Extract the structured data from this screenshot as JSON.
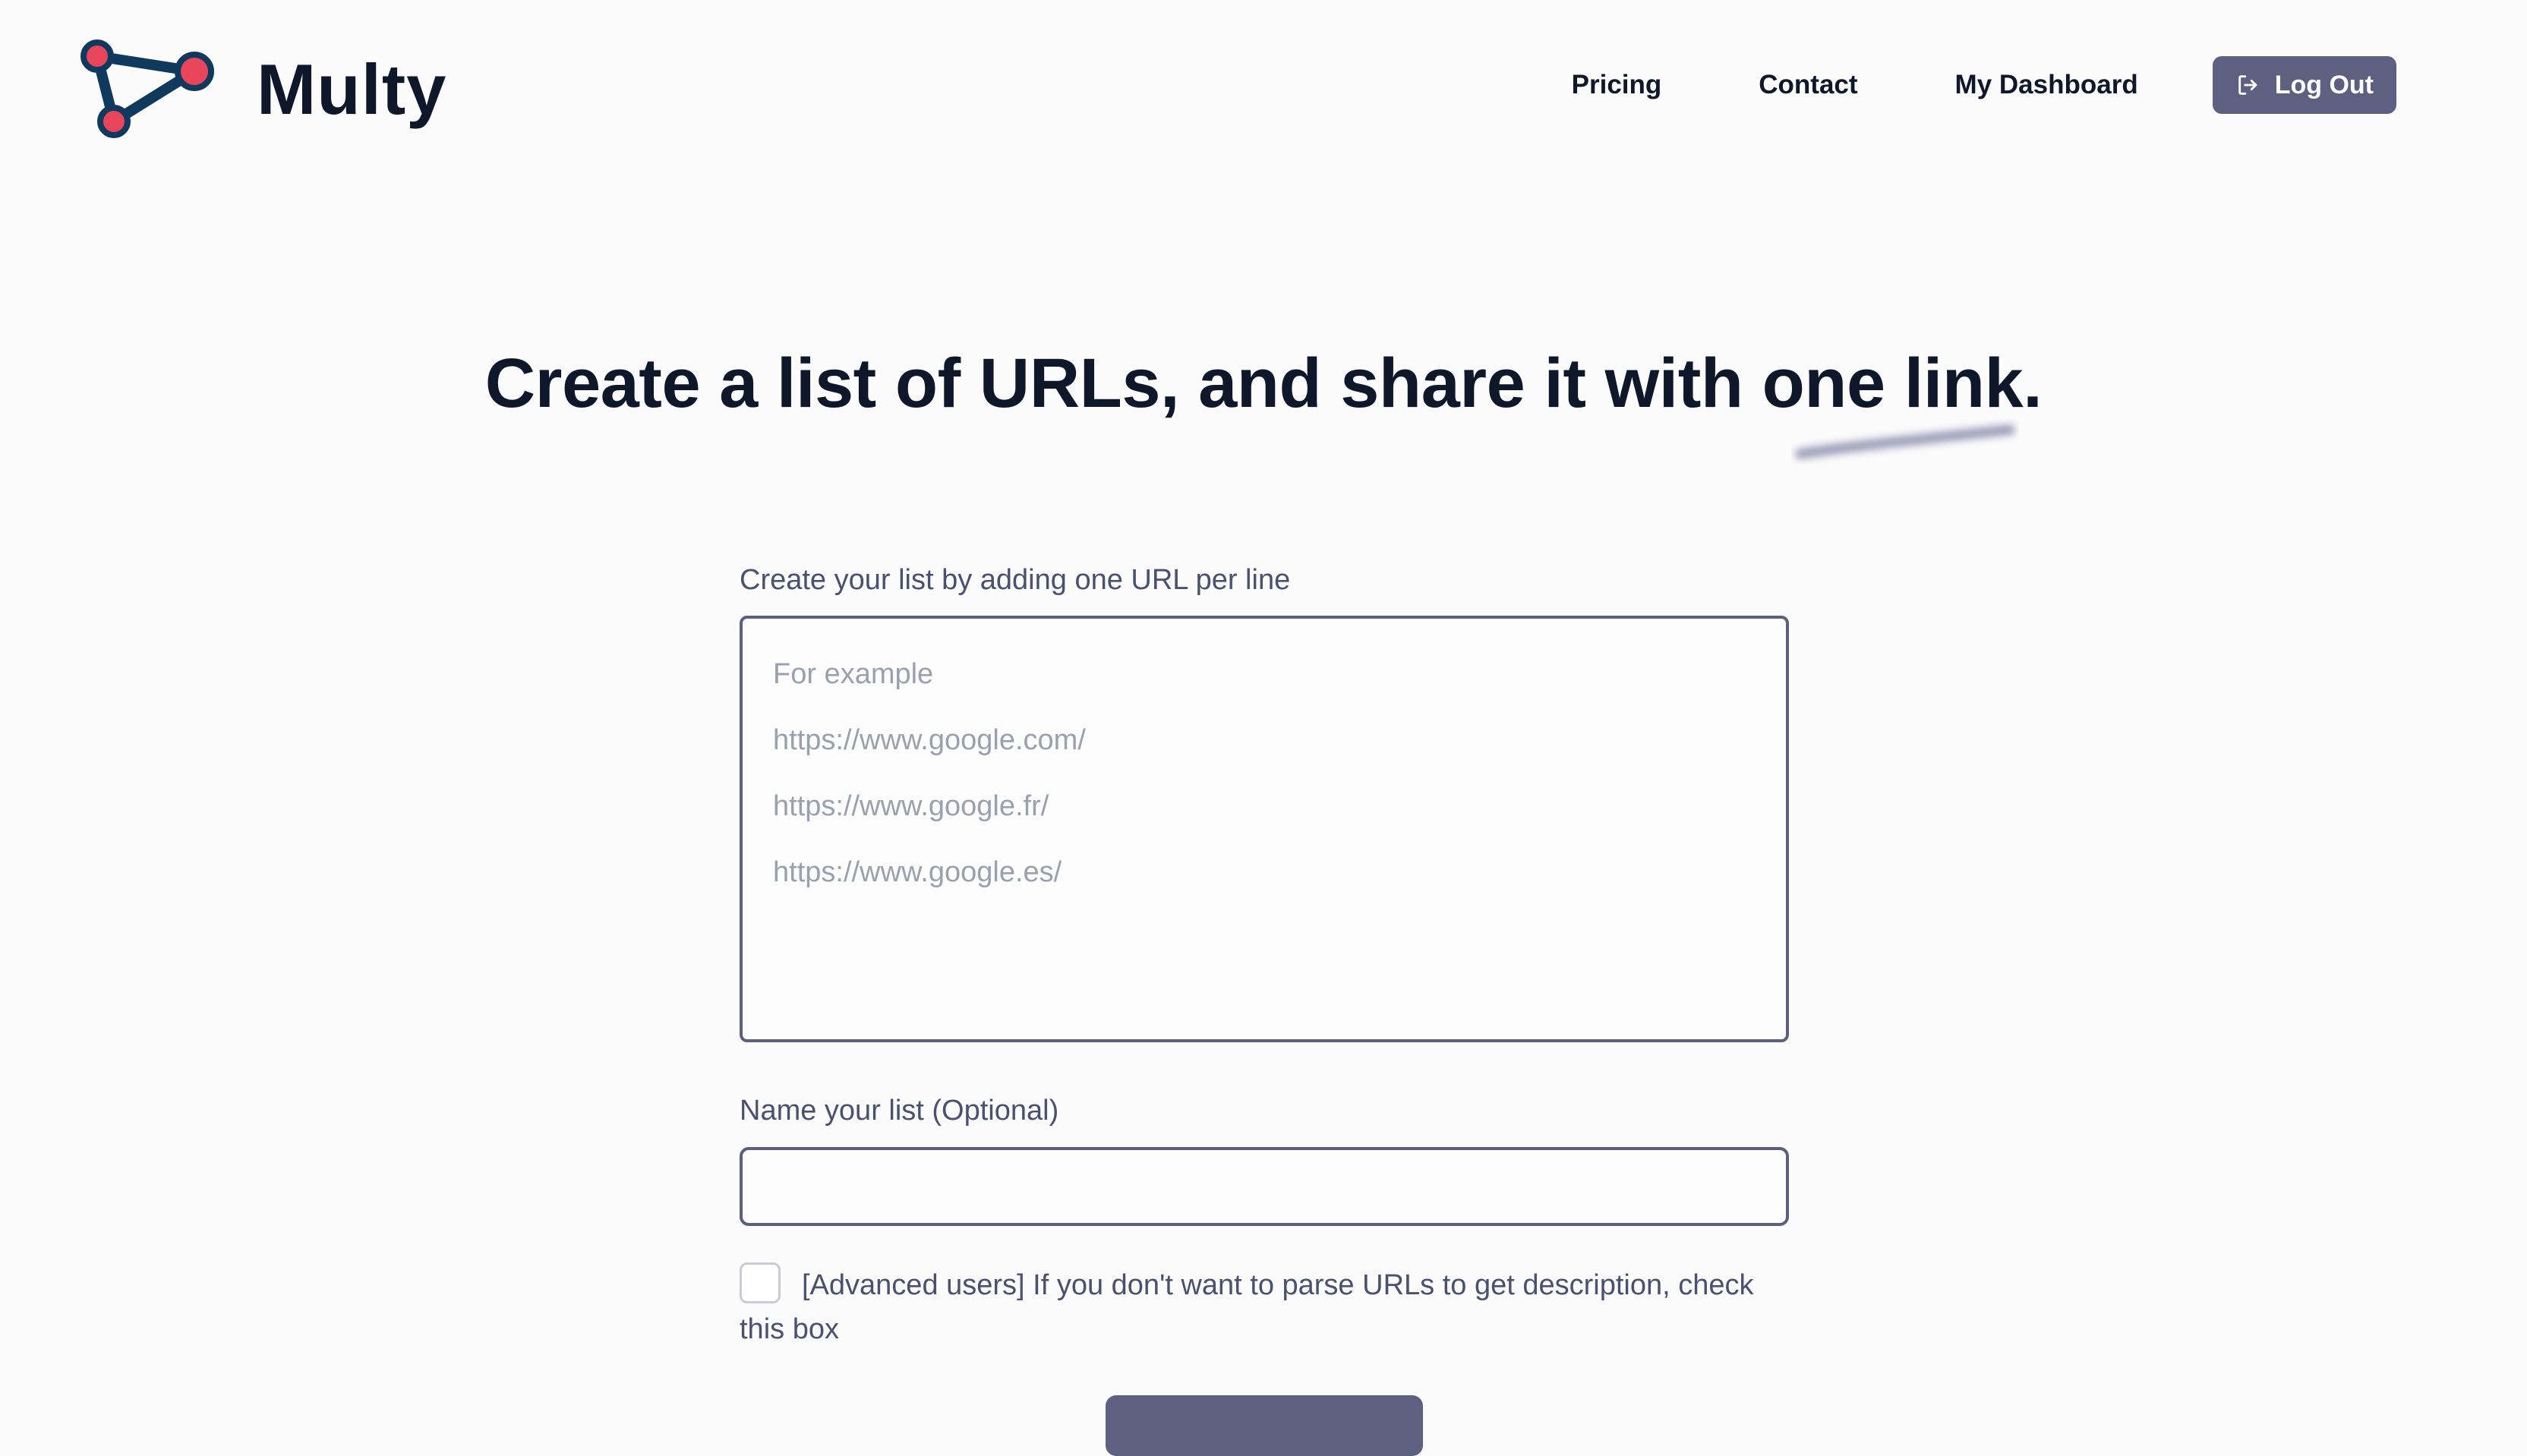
{
  "brand": {
    "name": "Multy",
    "colors": {
      "dark": "#0f3a5e",
      "accent": "#e8445a"
    }
  },
  "nav": {
    "items": [
      {
        "label": "Pricing"
      },
      {
        "label": "Contact"
      },
      {
        "label": "My Dashboard"
      }
    ],
    "logout": {
      "label": "Log Out",
      "icon": "logout-icon"
    }
  },
  "hero": {
    "title": "Create a list of URLs, and share it with one link."
  },
  "form": {
    "urls_label": "Create your list by adding one URL per line",
    "urls_value": "",
    "urls_placeholder_lines": [
      "For example",
      "https://www.google.com/",
      "https://www.google.fr/",
      "https://www.google.es/"
    ],
    "name_label": "Name your list (Optional)",
    "name_value": "",
    "advanced_checkbox": {
      "checked": false,
      "label": "[Advanced users] If you don't want to parse URLs to get description, check this box"
    }
  },
  "colors": {
    "primary_button": "#5d6080",
    "border": "#5b6080",
    "text_muted": "#4a5170",
    "placeholder": "#9aa0ad"
  }
}
